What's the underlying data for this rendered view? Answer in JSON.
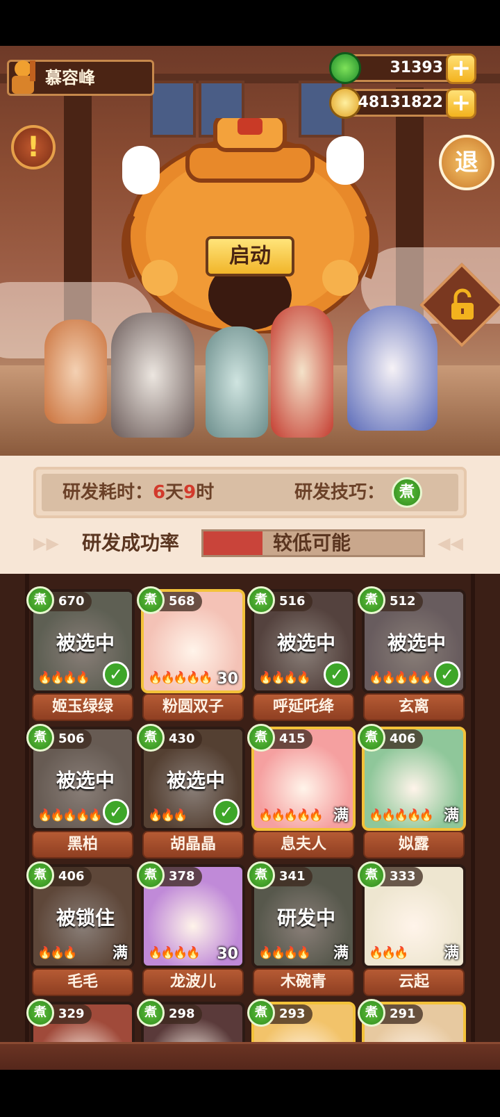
{
  "player": {
    "name": "慕容峰"
  },
  "currency": {
    "jade": "31393",
    "coins": "48131822",
    "plus": "+"
  },
  "buttons": {
    "alert": "!",
    "exit": "退",
    "start": "启动"
  },
  "research": {
    "time_label": "研发耗时：",
    "days": "6",
    "day_unit": "天",
    "hours": "9",
    "hour_unit": "时",
    "skill_label": "研发技巧：",
    "skill_value": "煮",
    "rate_label": "研发成功率",
    "rate_text": "较低可能",
    "rate_fraction": 0.27
  },
  "colors": {
    "accent_red": "#d23a2c",
    "badge_green": "#3ea629",
    "gold": "#f3b21e"
  },
  "characters": [
    {
      "badge": "煮",
      "level": "670",
      "name": "姬玉绿绿",
      "status": "被选中",
      "flames": 4,
      "corner": "check",
      "theme": "#9fb09a"
    },
    {
      "badge": "煮",
      "level": "568",
      "name": "粉圆双子",
      "status": "",
      "flames": 5,
      "corner": "30",
      "theme": "#f4c2b6",
      "gold": true
    },
    {
      "badge": "煮",
      "level": "516",
      "name": "呼延吒绛",
      "status": "被选中",
      "flames": 4,
      "corner": "check",
      "theme": "#8a6f6a"
    },
    {
      "badge": "煮",
      "level": "512",
      "name": "玄离",
      "status": "被选中",
      "flames": 5,
      "corner": "check",
      "theme": "#b7a9b2"
    },
    {
      "badge": "煮",
      "level": "506",
      "name": "黑柏",
      "status": "被选中",
      "flames": 5,
      "corner": "check",
      "theme": "#b3a79a"
    },
    {
      "badge": "煮",
      "level": "430",
      "name": "胡晶晶",
      "status": "被选中",
      "flames": 3,
      "corner": "check",
      "theme": "#8a6a50"
    },
    {
      "badge": "煮",
      "level": "415",
      "name": "息夫人",
      "status": "",
      "flames": 5,
      "corner": "满",
      "theme": "#f5a0a0",
      "gold": true
    },
    {
      "badge": "煮",
      "level": "406",
      "name": "姒露",
      "status": "",
      "flames": 5,
      "corner": "满",
      "theme": "#8fc79a",
      "gold": true
    },
    {
      "badge": "煮",
      "level": "406",
      "name": "毛毛",
      "status": "被锁住",
      "flames": 3,
      "corner": "满",
      "theme": "#a07a60"
    },
    {
      "badge": "煮",
      "level": "378",
      "name": "龙波儿",
      "status": "",
      "flames": 4,
      "corner": "30",
      "theme": "#c08ad8"
    },
    {
      "badge": "煮",
      "level": "341",
      "name": "木碗青",
      "status": "研发中",
      "flames": 4,
      "corner": "满",
      "theme": "#90a08a"
    },
    {
      "badge": "煮",
      "level": "333",
      "name": "云起",
      "status": "",
      "flames": 3,
      "corner": "满",
      "theme": "#eee6d0"
    },
    {
      "badge": "煮",
      "level": "329",
      "name": "",
      "status": "",
      "flames": 0,
      "corner": "",
      "theme": "#a04a3a"
    },
    {
      "badge": "煮",
      "level": "298",
      "name": "",
      "status": "",
      "flames": 0,
      "corner": "",
      "theme": "#5a3a3a"
    },
    {
      "badge": "煮",
      "level": "293",
      "name": "",
      "status": "",
      "flames": 0,
      "corner": "",
      "theme": "#f2c36a",
      "gold": true
    },
    {
      "badge": "煮",
      "level": "291",
      "name": "",
      "status": "",
      "flames": 0,
      "corner": "",
      "theme": "#e7c9a0",
      "gold": true
    }
  ]
}
